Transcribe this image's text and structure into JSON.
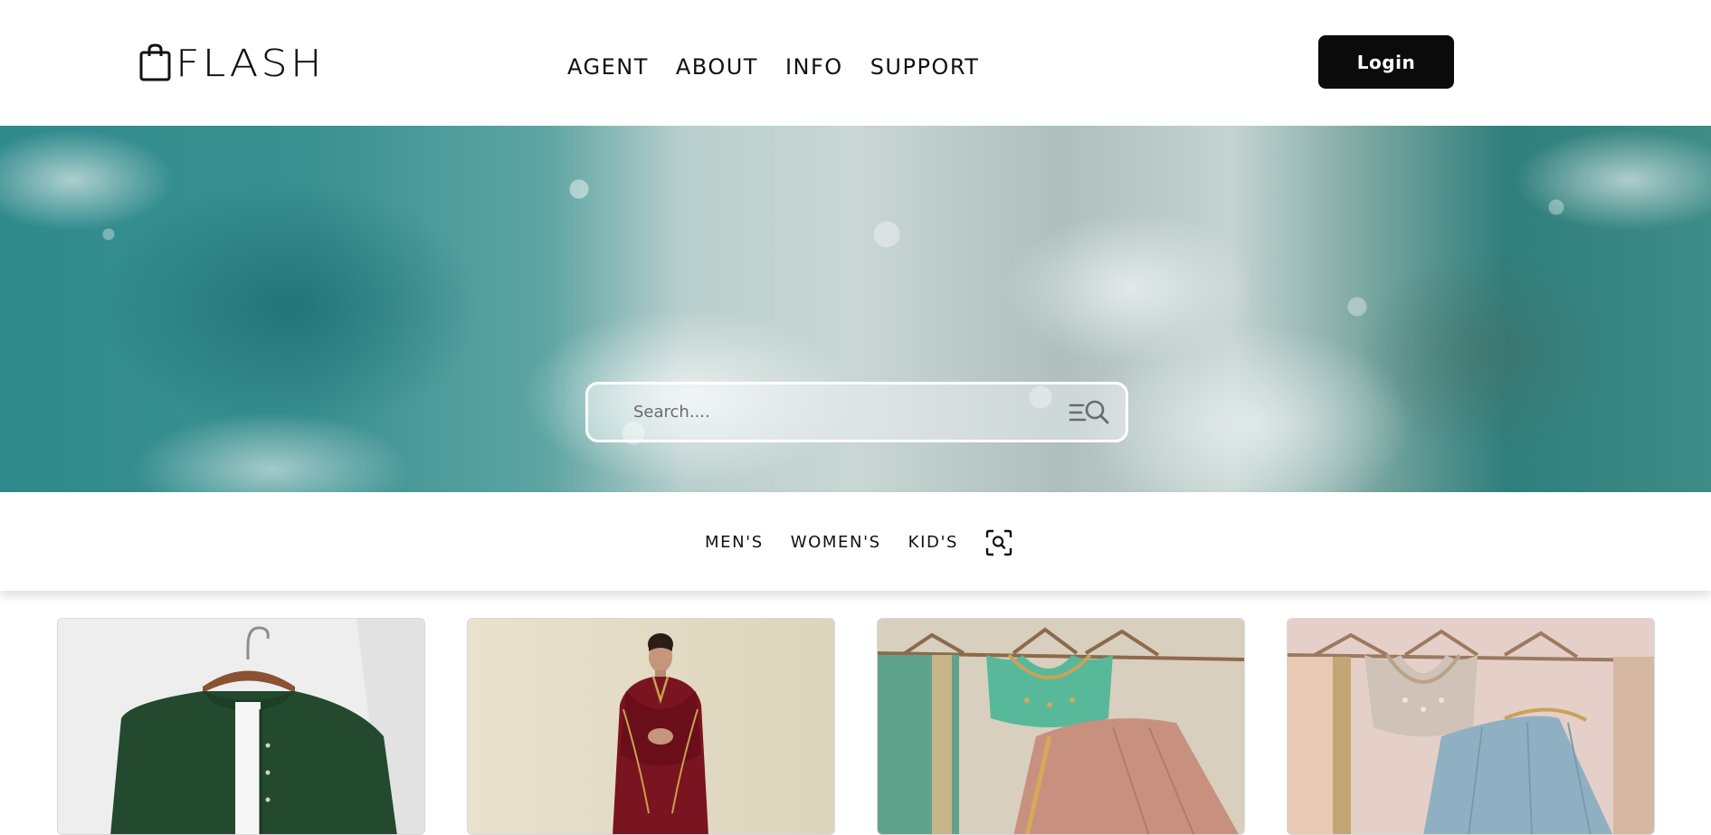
{
  "header": {
    "brand": "FLASH",
    "nav": [
      "AGENT",
      "ABOUT",
      "INFO",
      "SUPPORT"
    ],
    "login_label": "Login"
  },
  "hero": {
    "search_placeholder": "Search...."
  },
  "categories": [
    "MEN'S",
    "WOMEN'S",
    "KID'S"
  ],
  "products": [
    {
      "label": "green mandarin-collar shirt on hanger"
    },
    {
      "label": "woman in maroon velvet suit"
    },
    {
      "label": "mint blouse and peach lehenga on hangers"
    },
    {
      "label": "embellished blouse and blue lehenga on hangers"
    }
  ],
  "colors": {
    "primary": "#0b0b0b",
    "background": "#ffffff",
    "hero_teal": "#2f8a8c"
  }
}
